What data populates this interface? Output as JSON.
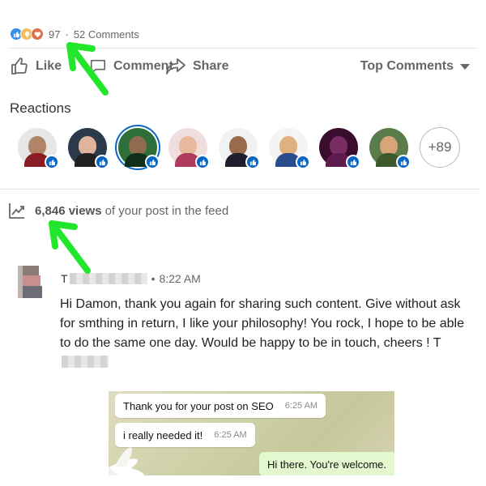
{
  "social_counts": {
    "reaction_icons": [
      "like-icon",
      "insightful-icon",
      "love-icon"
    ],
    "reaction_count": "97",
    "separator": "·",
    "comments": "52 Comments"
  },
  "actions": {
    "like": "Like",
    "comment": "Comment",
    "share": "Share",
    "sort": "Top Comments"
  },
  "reactions": {
    "title": "Reactions",
    "avatars": [
      {
        "bg": "#e6e6e6",
        "face": "#b08567",
        "shirt": "#8a1d24"
      },
      {
        "bg": "#2a3a4a",
        "face": "#e1b39a",
        "shirt": "#222222"
      },
      {
        "bg": "#2d6e3a",
        "face": "#8f6b4f",
        "shirt": "#0f2f1a"
      },
      {
        "bg": "#f0dede",
        "face": "#e6b89c",
        "shirt": "#b03a5b"
      },
      {
        "bg": "#f2f2f2",
        "face": "#9a6a4c",
        "shirt": "#1e1e2e"
      },
      {
        "bg": "#f4f4f4",
        "face": "#e0b07f",
        "shirt": "#2b4c8c"
      },
      {
        "bg": "#3a0d2f",
        "face": "#7a2d62",
        "shirt": "#5e1b4d"
      },
      {
        "bg": "#5a7c4a",
        "face": "#d8a47a",
        "shirt": "#3d5a2e"
      }
    ],
    "more": "+89"
  },
  "views": {
    "count": "6,846 views",
    "suffix": "of your post in the feed"
  },
  "comment": {
    "author_initial": "T",
    "separator": "•",
    "time": "8:22 AM",
    "text": "Hi Damon, thank you again for sharing such content. Give without ask for smthing in return, I like your philosophy! You rock, I hope to be able to do the same one day. Would be happy to be in touch, cheers ! T"
  },
  "chat": {
    "messages": [
      {
        "text": "Thank you for your post on SEO",
        "time": "6:25 AM"
      },
      {
        "text": "i really needed it!",
        "time": "6:25 AM"
      },
      {
        "text": "Hi there.  You're welcome.",
        "time": ""
      }
    ]
  },
  "colors": {
    "linkedin_blue": "#0a66c2",
    "annotation_arrow": "#22e62a",
    "text_muted": "#666666"
  }
}
